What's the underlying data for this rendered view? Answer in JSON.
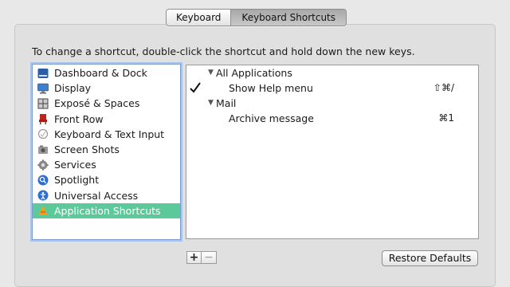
{
  "tabs": [
    {
      "label": "Keyboard",
      "selected": false
    },
    {
      "label": "Keyboard Shortcuts",
      "selected": true
    }
  ],
  "instruction": "To change a shortcut, double-click the shortcut and hold down the new keys.",
  "categories": [
    {
      "label": "Dashboard & Dock",
      "icon": "dashboard-dock-icon"
    },
    {
      "label": "Display",
      "icon": "display-icon"
    },
    {
      "label": "Exposé & Spaces",
      "icon": "expose-spaces-icon"
    },
    {
      "label": "Front Row",
      "icon": "front-row-icon"
    },
    {
      "label": "Keyboard & Text Input",
      "icon": "keyboard-text-input-icon"
    },
    {
      "label": "Screen Shots",
      "icon": "screen-shots-icon"
    },
    {
      "label": "Services",
      "icon": "services-gear-icon"
    },
    {
      "label": "Spotlight",
      "icon": "spotlight-icon"
    },
    {
      "label": "Universal Access",
      "icon": "universal-access-icon"
    },
    {
      "label": "Application Shortcuts",
      "icon": "application-shortcuts-icon",
      "selected": true
    }
  ],
  "shortcuts": {
    "group1": {
      "label": "All Applications",
      "expanded": true
    },
    "item1": {
      "name": "Show Help menu",
      "keys": "⇧⌘/",
      "checked": true
    },
    "group2": {
      "label": "Mail",
      "expanded": true
    },
    "item2": {
      "name": "Archive message",
      "keys": "⌘1",
      "checked": false
    }
  },
  "buttons": {
    "add": "+",
    "remove": "−",
    "restore": "Restore Defaults"
  },
  "colors": {
    "selection": "#5bc99a",
    "list_focus_ring": "#a9c3ea"
  }
}
